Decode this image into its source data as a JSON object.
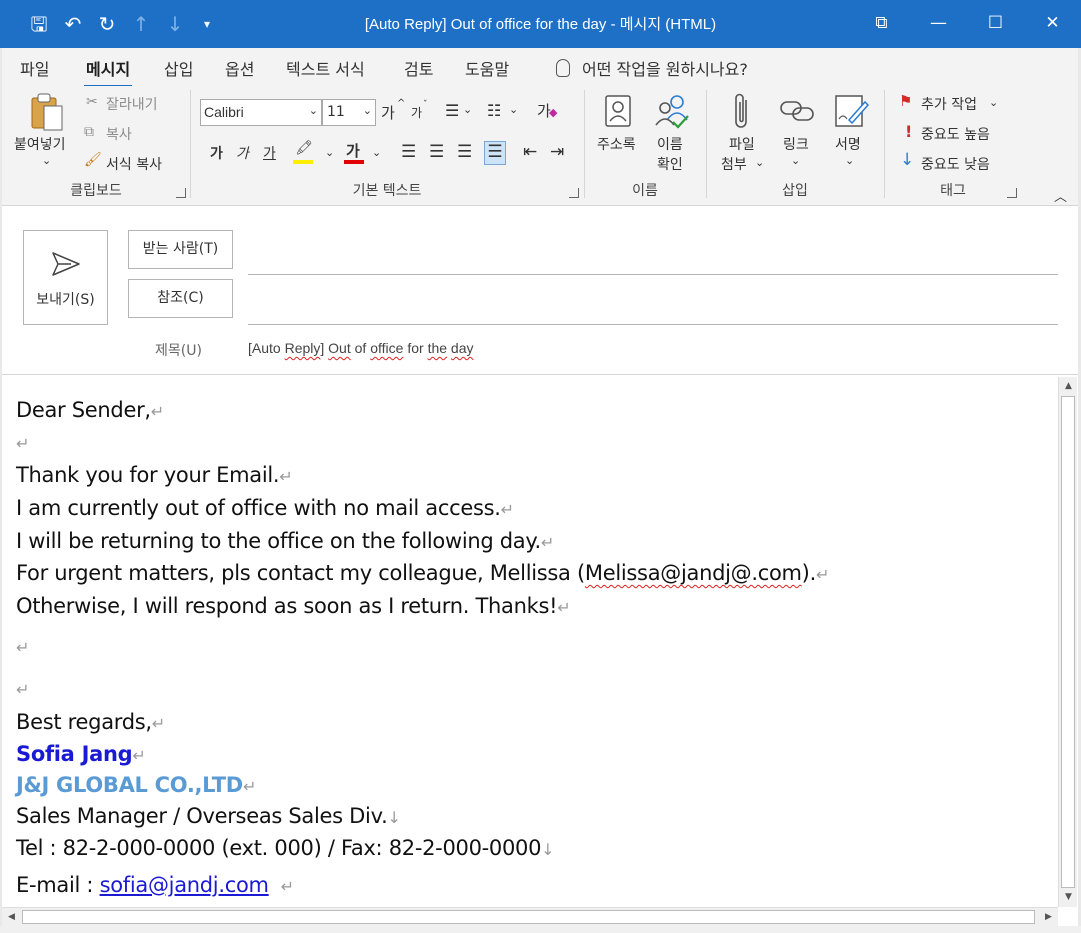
{
  "window": {
    "title": "[Auto Reply] Out of office for the day  -  메시지 (HTML)",
    "minimize": "—",
    "maximize": "☐",
    "close": "✕",
    "restore_tiles": "⧉"
  },
  "qat": {
    "save": "🖫",
    "undo": "↶",
    "redo": "↻",
    "up": "↑",
    "down": "↓",
    "more": "▾"
  },
  "tabs": [
    {
      "label": "파일"
    },
    {
      "label": "메시지"
    },
    {
      "label": "삽입"
    },
    {
      "label": "옵션"
    },
    {
      "label": "텍스트 서식"
    },
    {
      "label": "검토"
    },
    {
      "label": "도움말"
    }
  ],
  "tell_me": "어떤 작업을 원하시나요?",
  "ribbon": {
    "clipboard": {
      "label": "클립보드",
      "paste": "붙여넣기",
      "cut": "잘라내기",
      "copy": "복사",
      "format_painter": "서식 복사"
    },
    "basic_text": {
      "label": "기본 텍스트",
      "font": "Calibri",
      "size": "11",
      "grow": "가",
      "shrink": "가",
      "bold": "가",
      "italic": "가",
      "underline": "가",
      "font_color_char": "가",
      "clear": "가"
    },
    "names": {
      "label": "이름",
      "address_book": "주소록",
      "check_names_1": "이름",
      "check_names_2": "확인"
    },
    "include": {
      "label": "삽입",
      "attach_1": "파일",
      "attach_2": "첨부",
      "link": "링크",
      "signature": "서명"
    },
    "tags": {
      "label": "태그",
      "follow_up": "추가 작업",
      "high": "중요도 높음",
      "low": "중요도 낮음"
    }
  },
  "compose": {
    "send": "보내기(S)",
    "to": "받는 사람(T)",
    "cc": "참조(C)",
    "subject_label": "제목(U)",
    "subject_parts": [
      "[Auto ",
      "Reply",
      "] ",
      "Out",
      " of ",
      "office",
      " for ",
      "the",
      " ",
      "day"
    ]
  },
  "body": {
    "greeting": "Dear Sender,",
    "l1": "Thank you for your Email.",
    "l2": "I am currently out of office with no mail access.",
    "l3": "I will be returning to the office on the following day.",
    "l4a": "For urgent matters, pls contact my colleague, Mellissa (",
    "l4b": "Melissa@jandj@.com",
    "l4c": ").",
    "l5": "Otherwise, I will respond as soon as I return. Thanks!",
    "closing": "Best regards,",
    "name": "Sofia Jang",
    "company": "J&J GLOBAL CO.,LTD",
    "title": "Sales Manager / Overseas Sales Div.",
    "tel": "Tel : 82-2-000-0000 (ext. 000) / Fax: 82-2-000-0000",
    "email_label": "E-mail : ",
    "email": "sofia@jandj.com",
    "para_mark": "↵",
    "line_break_mark": "↓"
  },
  "colors": {
    "titlebar": "#1e70c7",
    "ribbon_bg": "#f3f3f3",
    "signature_name": "#1a1ad4",
    "signature_company": "#5b9bd5"
  }
}
